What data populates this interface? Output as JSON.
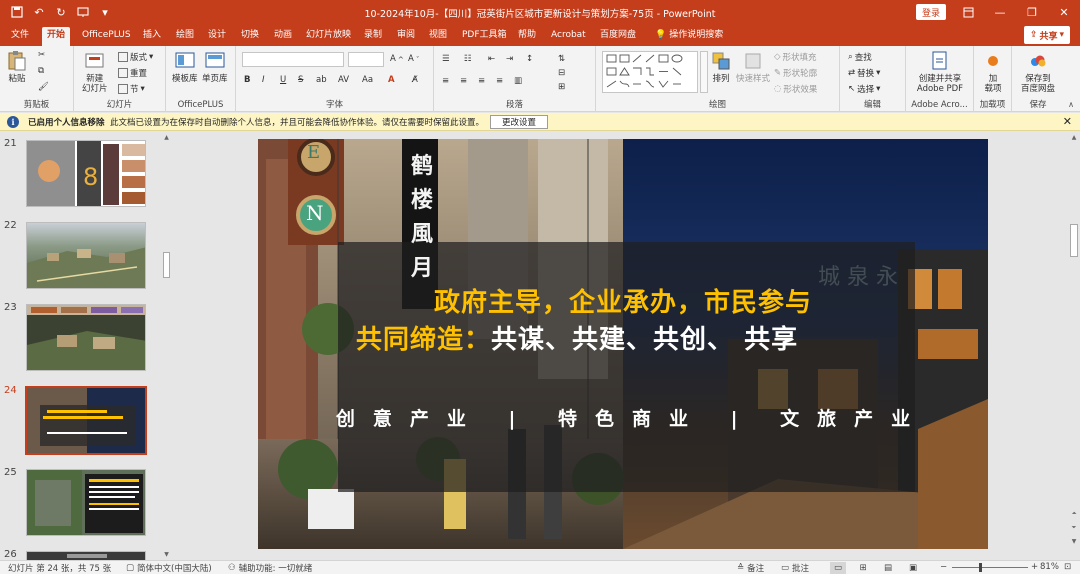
{
  "titlebar": {
    "title": "10-2024年10月-【四川】冠英街片区城市更新设计与策划方案-75页  -  PowerPoint",
    "login_label": "登录",
    "qat": [
      "save-icon",
      "undo-icon",
      "redo-icon",
      "present-icon",
      "customize-icon"
    ]
  },
  "tabs": [
    "文件",
    "开始",
    "OfficePLUS",
    "插入",
    "绘图",
    "设计",
    "切换",
    "动画",
    "幻灯片放映",
    "录制",
    "审阅",
    "视图",
    "PDF工具箱",
    "帮助",
    "Acrobat",
    "百度网盘",
    "操作说明搜索"
  ],
  "active_tab": "开始",
  "share_label": "共享",
  "ribbon": {
    "clipboard": {
      "paste": "粘贴",
      "group": "剪贴板"
    },
    "slides": {
      "new_slide_1": "新建",
      "new_slide_2": "幻灯片",
      "layout": "版式",
      "reset": "重置",
      "section": "节",
      "group": "幻灯片"
    },
    "officeplus": {
      "template": "模板库",
      "single_page": "单页库",
      "group": "OfficePLUS"
    },
    "font": {
      "bold": "B",
      "italic": "I",
      "underline": "U",
      "strike": "S",
      "shadow": "ab",
      "spacing": "AV",
      "case": "Aa",
      "group": "字体"
    },
    "paragraph": {
      "group": "段落"
    },
    "drawing": {
      "arrange": "排列",
      "quick_styles": "快速样式",
      "shape_fill": "形状填充",
      "shape_outline": "形状轮廓",
      "shape_effects": "形状效果",
      "group": "绘图"
    },
    "editing": {
      "find": "查找",
      "replace": "替换",
      "select": "选择",
      "group": "编辑"
    },
    "adobe": {
      "create_1": "创建并共享",
      "create_2": "Adobe PDF",
      "group": "Adobe Acro..."
    },
    "addins": {
      "addins_1": "加",
      "addins_2": "载项",
      "group": "加载项"
    },
    "save": {
      "save_1": "保存到",
      "save_2": "百度网盘",
      "group": "保存"
    }
  },
  "infobar": {
    "title": "已启用个人信息移除",
    "message": "此文档已设置为在保存时自动删除个人信息，并且可能会降低协作体验。请仅在需要时保留此设置。",
    "button": "更改设置"
  },
  "thumbnails": [
    {
      "num": "21",
      "active": false
    },
    {
      "num": "22",
      "active": false
    },
    {
      "num": "23",
      "active": false
    },
    {
      "num": "24",
      "active": true
    },
    {
      "num": "25",
      "active": false
    },
    {
      "num": "26",
      "active": false
    }
  ],
  "slide": {
    "headline_1": "政府主导，企业承办，市民参与",
    "headline_2_yellow": "共同缔造：",
    "headline_2_white": "共谋、共建、共创、 共享",
    "tagline": "创意产业 | 特色商业 | 文旅产业",
    "sign_letters": [
      "E",
      "N"
    ],
    "banner_text": "鹤 楼 風 月"
  },
  "statusbar": {
    "slide_info": "幻灯片 第 24 张，共 75 张",
    "language": "简体中文(中国大陆)",
    "accessibility": "辅助功能: 一切就绪",
    "notes": "备注",
    "comments": "批注",
    "zoom": "81%"
  },
  "colors": {
    "accent": "#c43e1c",
    "headline_yellow": "#ffc000",
    "infobar_bg": "#fdf5c4"
  }
}
